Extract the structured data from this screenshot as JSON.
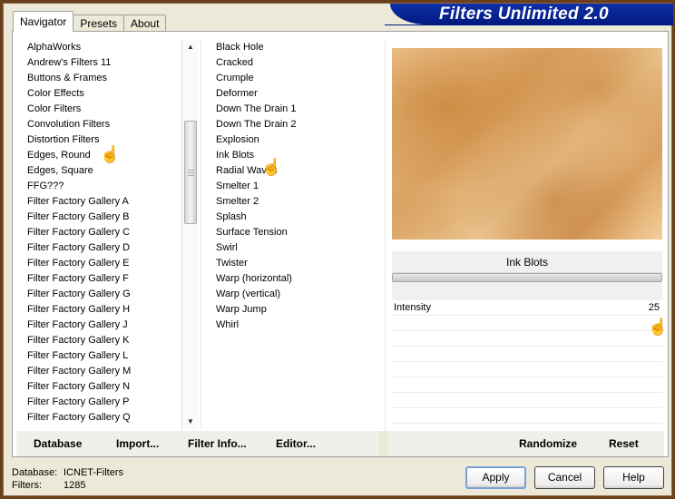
{
  "window": {
    "title": "Filters Unlimited 2.0"
  },
  "tabs": [
    {
      "label": "Navigator",
      "active": true
    },
    {
      "label": "Presets",
      "active": false
    },
    {
      "label": "About",
      "active": false
    }
  ],
  "categories": [
    "AlphaWorks",
    "Andrew's Filters 11",
    "Buttons & Frames",
    "Color Effects",
    "Color Filters",
    "Convolution Filters",
    "Distortion Filters",
    "Edges, Round",
    "Edges, Square",
    "FFG???",
    "Filter Factory Gallery A",
    "Filter Factory Gallery B",
    "Filter Factory Gallery C",
    "Filter Factory Gallery D",
    "Filter Factory Gallery E",
    "Filter Factory Gallery F",
    "Filter Factory Gallery G",
    "Filter Factory Gallery H",
    "Filter Factory Gallery J",
    "Filter Factory Gallery K",
    "Filter Factory Gallery L",
    "Filter Factory Gallery M",
    "Filter Factory Gallery N",
    "Filter Factory Gallery P",
    "Filter Factory Gallery Q"
  ],
  "selected_category": "Distortion Filters",
  "filters": [
    "Black Hole",
    "Cracked",
    "Crumple",
    "Deformer",
    "Down The Drain 1",
    "Down The Drain 2",
    "Explosion",
    "Ink Blots",
    "Radial Waves",
    "Smelter 1",
    "Smelter 2",
    "Splash",
    "Surface Tension",
    "Swirl",
    "Twister",
    "Warp (horizontal)",
    "Warp (vertical)",
    "Warp Jump",
    "Whirl"
  ],
  "selected_filter": "Ink Blots",
  "filter_title": "Ink Blots",
  "params": [
    {
      "label": "Intensity",
      "value": "25"
    }
  ],
  "panel_buttons": {
    "database": "Database",
    "import": "Import...",
    "filter_info": "Filter Info...",
    "editor": "Editor...",
    "randomize": "Randomize",
    "reset": "Reset"
  },
  "footer": {
    "database_label": "Database:",
    "database_value": "ICNET-Filters",
    "filters_label": "Filters:",
    "filters_value": "1285"
  },
  "dialog_buttons": {
    "apply": "Apply",
    "cancel": "Cancel",
    "help": "Help"
  },
  "icons": {
    "cursor": "hand-pointer-icon",
    "scroll_up": "triangle-up-icon",
    "scroll_down": "triangle-down-icon"
  }
}
